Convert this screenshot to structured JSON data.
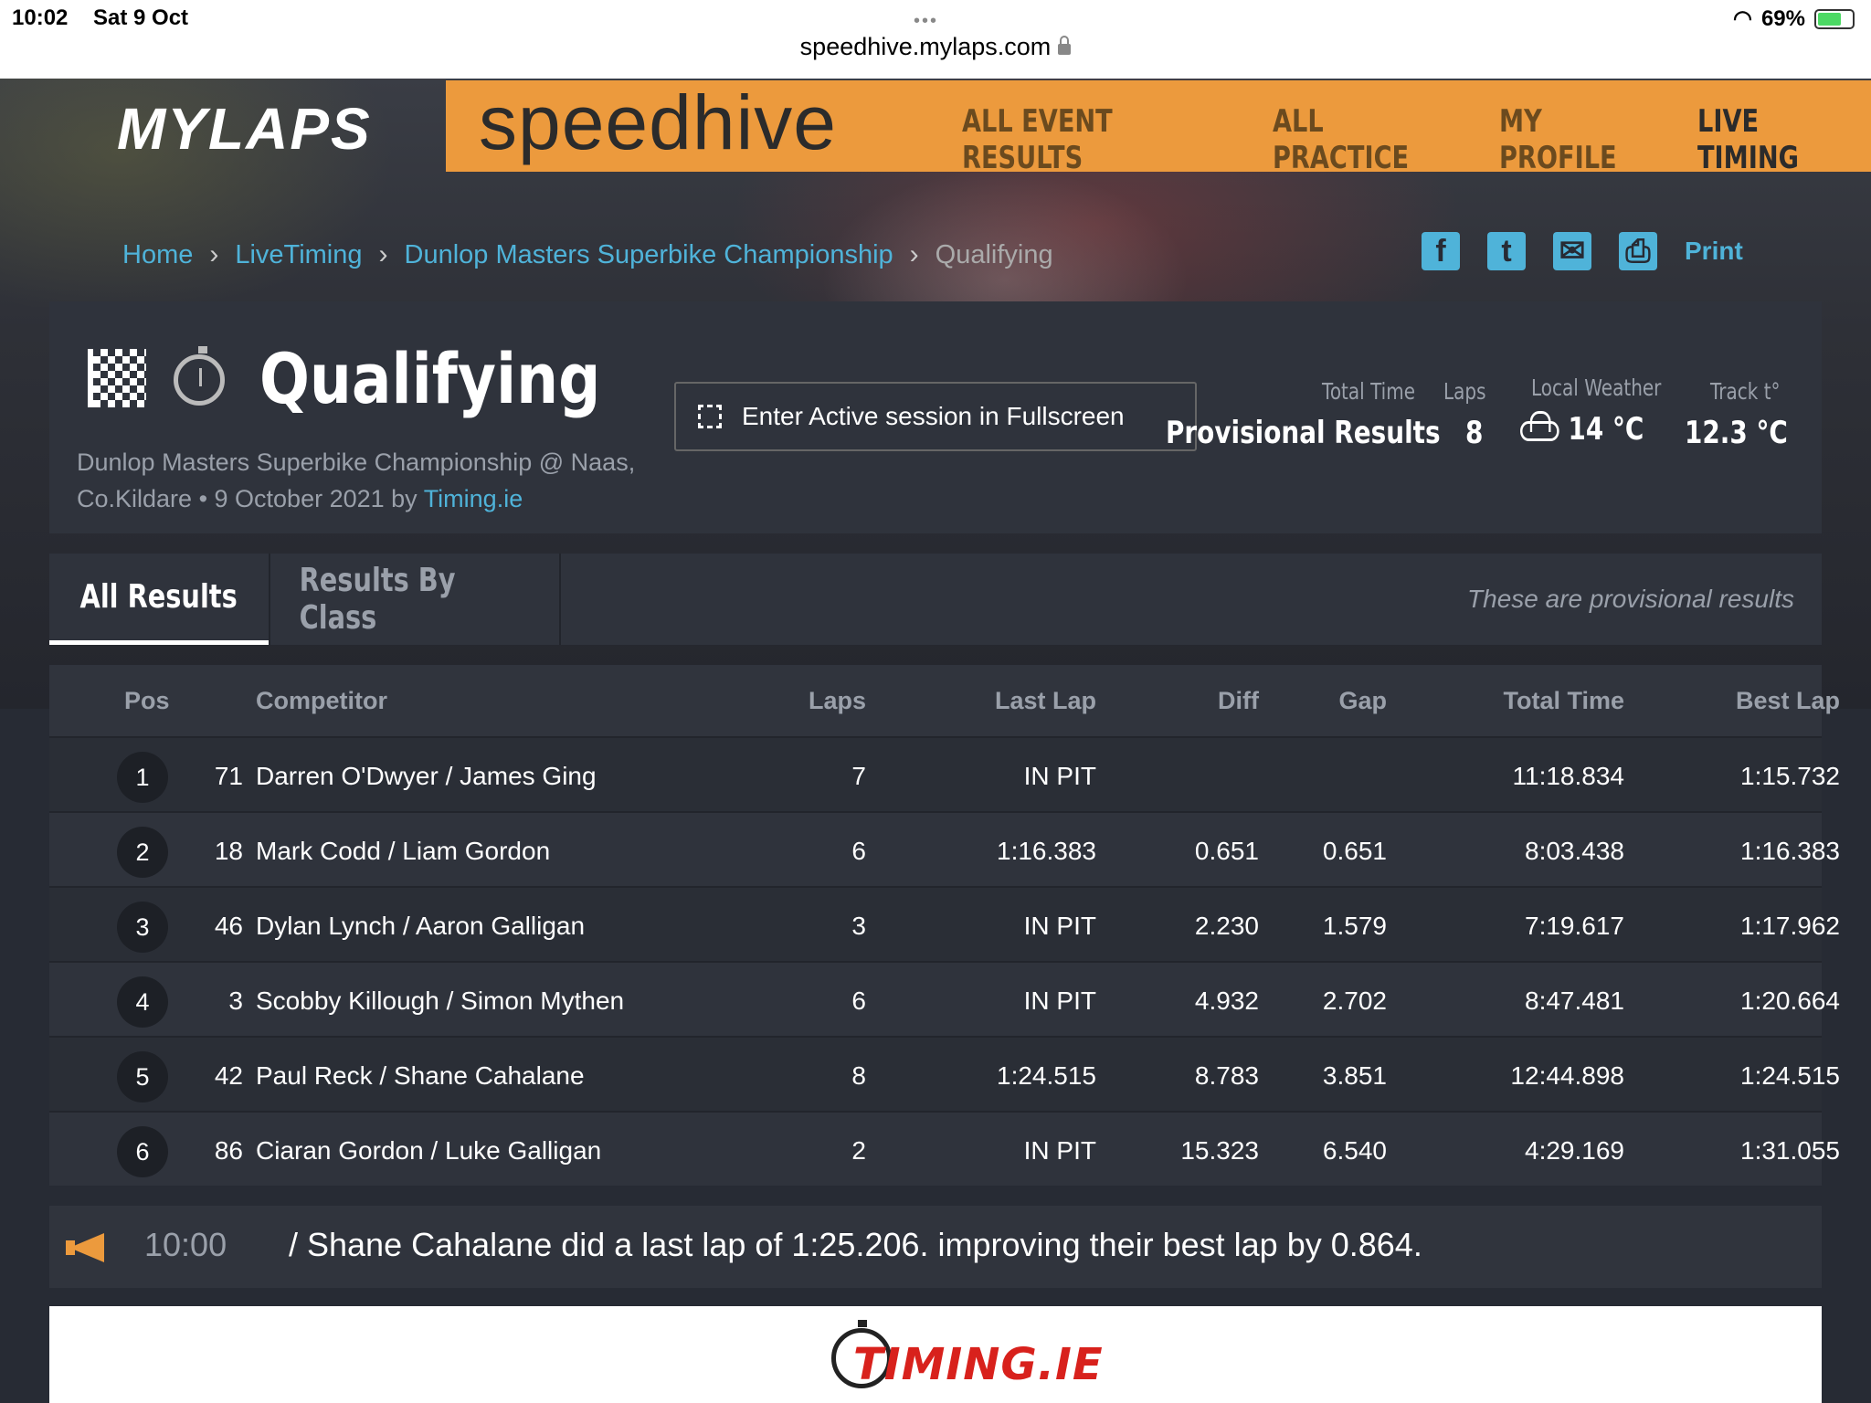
{
  "statusbar": {
    "time": "10:02",
    "date": "Sat 9 Oct",
    "url": "speedhive.mylaps.com",
    "battery": "69%",
    "dots": "•••"
  },
  "brand": {
    "mylaps": "MYLAPS",
    "speedhive": "speedhive"
  },
  "nav": [
    "ALL EVENT RESULTS",
    "ALL PRACTICE",
    "MY PROFILE",
    "LIVE TIMING"
  ],
  "breadcrumb": {
    "home": "Home",
    "live": "LiveTiming",
    "event": "Dunlop Masters Superbike Championship",
    "current": "Qualifying"
  },
  "share": {
    "facebook": "f",
    "twitter": "t",
    "email": "✉",
    "printer": "⎙",
    "print": "Print"
  },
  "session": {
    "title": "Qualifying",
    "subtitle": "Dunlop Masters Superbike Championship @ Naas, Co.Kildare • 9 October 2021 by",
    "organizer": "Timing.ie",
    "fullscreen": "Enter Active session in Fullscreen"
  },
  "stats": {
    "total_time_label": "Total Time",
    "total_time": "Provisional Results",
    "laps_label": "Laps",
    "laps": "8",
    "weather_label": "Local Weather",
    "weather": "14 °C",
    "track_label": "Track t°",
    "track": "12.3 °C"
  },
  "tabs": {
    "all": "All Results",
    "class": "Results By Class",
    "note": "These are provisional results"
  },
  "columns": {
    "pos": "Pos",
    "competitor": "Competitor",
    "laps": "Laps",
    "last": "Last Lap",
    "diff": "Diff",
    "gap": "Gap",
    "total": "Total Time",
    "best": "Best Lap"
  },
  "rows": [
    {
      "pos": "1",
      "num": "71",
      "name": "Darren O'Dwyer / James Ging",
      "laps": "7",
      "last": "IN PIT",
      "diff": "",
      "gap": "",
      "total": "11:18.834",
      "best": "1:15.732"
    },
    {
      "pos": "2",
      "num": "18",
      "name": "Mark Codd / Liam Gordon",
      "laps": "6",
      "last": "1:16.383",
      "diff": "0.651",
      "gap": "0.651",
      "total": "8:03.438",
      "best": "1:16.383"
    },
    {
      "pos": "3",
      "num": "46",
      "name": "Dylan Lynch / Aaron Galligan",
      "laps": "3",
      "last": "IN PIT",
      "diff": "2.230",
      "gap": "1.579",
      "total": "7:19.617",
      "best": "1:17.962"
    },
    {
      "pos": "4",
      "num": "3",
      "name": "Scobby Killough / Simon Mythen",
      "laps": "6",
      "last": "IN PIT",
      "diff": "4.932",
      "gap": "2.702",
      "total": "8:47.481",
      "best": "1:20.664"
    },
    {
      "pos": "5",
      "num": "42",
      "name": "Paul Reck / Shane Cahalane",
      "laps": "8",
      "last": "1:24.515",
      "diff": "8.783",
      "gap": "3.851",
      "total": "12:44.898",
      "best": "1:24.515"
    },
    {
      "pos": "6",
      "num": "86",
      "name": "Ciaran Gordon / Luke Galligan",
      "laps": "2",
      "last": "IN PIT",
      "diff": "15.323",
      "gap": "6.540",
      "total": "4:29.169",
      "best": "1:31.055"
    }
  ],
  "feed": {
    "time": "10:00",
    "message": "/ Shane Cahalane did a last lap of 1:25.206. improving their best lap by 0.864."
  },
  "footer": {
    "logo": "TIMING.IE"
  }
}
